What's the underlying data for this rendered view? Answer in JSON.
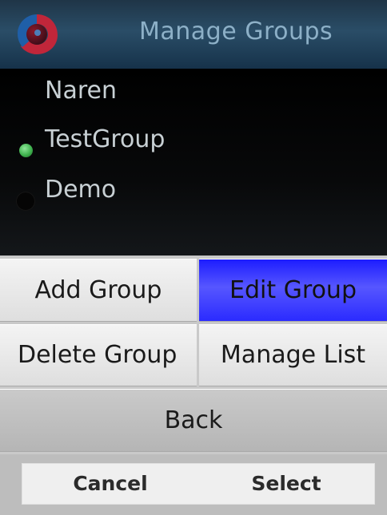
{
  "header": {
    "title": "Manage Groups",
    "logo_icon": "app-logo-icon"
  },
  "groups": [
    {
      "label": "Naren",
      "selected": false,
      "radio_visible": false
    },
    {
      "label": "TestGroup",
      "selected": true,
      "radio_visible": true
    },
    {
      "label": "Demo",
      "selected": false,
      "radio_visible": true
    }
  ],
  "menu": {
    "add_group": "Add Group",
    "edit_group": "Edit Group",
    "delete_group": "Delete Group",
    "manage_list": "Manage List",
    "back": "Back",
    "highlighted": "Edit Group"
  },
  "softkeys": {
    "left": "Cancel",
    "right": "Select"
  },
  "colors": {
    "header_text": "#8db0c7",
    "highlight": "#2a2aff",
    "selected_radio": "#3fb24e"
  }
}
